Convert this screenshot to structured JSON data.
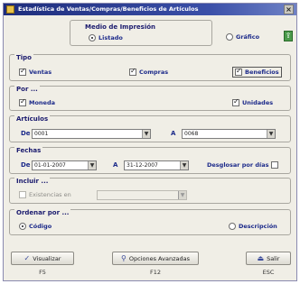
{
  "window": {
    "title": "Estadística de Ventas/Compras/Beneficios de Artículos",
    "close": "×"
  },
  "medio": {
    "label": "Medio de Impresión",
    "listado": "Listado",
    "grafico": "Gráfico",
    "selected": "Listado"
  },
  "tipo": {
    "label": "Tipo",
    "ventas": "Ventas",
    "compras": "Compras",
    "beneficios": "Beneficios"
  },
  "por": {
    "label": "Por ...",
    "moneda": "Moneda",
    "unidades": "Unidades"
  },
  "articulos": {
    "label": "Artículos",
    "de_label": "De",
    "de_value": "0001",
    "a_label": "A",
    "a_value": "0068"
  },
  "fechas": {
    "label": "Fechas",
    "de_label": "De",
    "de_value": "01-01-2007",
    "a_label": "A",
    "a_value": "31-12-2007",
    "desglosar": "Desglosar por días"
  },
  "incluir": {
    "label": "Incluir ...",
    "existencias": "Existencias en",
    "existencias_value": ""
  },
  "ordenar": {
    "label": "Ordenar por ...",
    "codigo": "Código",
    "descripcion": "Descripción",
    "selected": "Código"
  },
  "buttons": {
    "visualizar": "Visualizar",
    "visualizar_key": "F5",
    "opciones": "Opciones Avanzadas",
    "opciones_key": "F12",
    "salir": "Salir",
    "salir_key": "ESC"
  },
  "icons": {
    "export": "export-icon",
    "visualizar": "check-icon",
    "opciones": "search-icon",
    "salir": "exit-icon"
  }
}
